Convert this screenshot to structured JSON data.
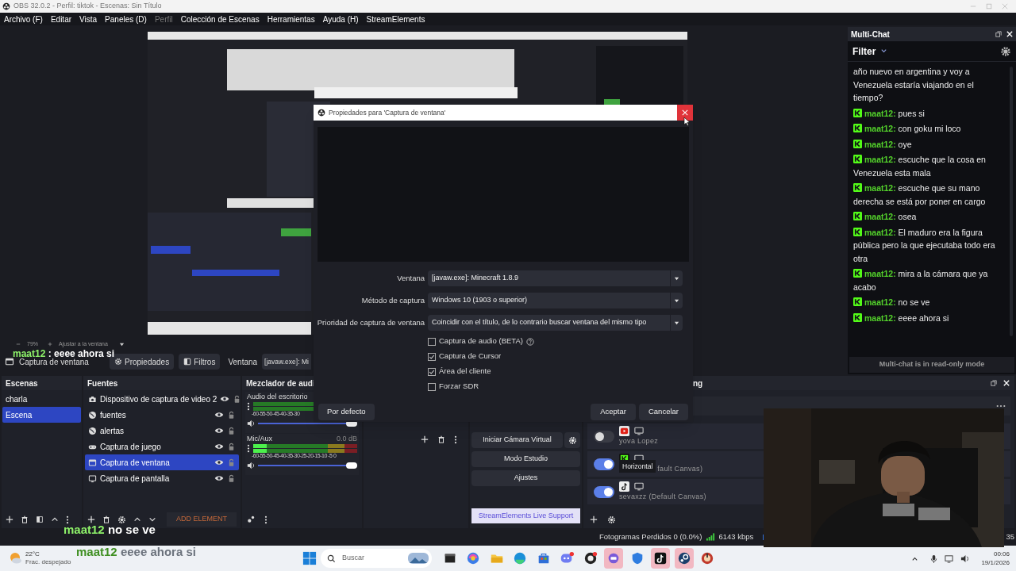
{
  "window": {
    "title": "OBS 32.0.2 - Perfil: tiktok - Escenas: Sin Título",
    "menu": [
      {
        "label": "Archivo (F)",
        "disabled": false
      },
      {
        "label": "Editar",
        "disabled": false
      },
      {
        "label": "Vista",
        "disabled": false
      },
      {
        "label": "Paneles (D)",
        "disabled": false
      },
      {
        "label": "Perfil",
        "disabled": true
      },
      {
        "label": "Colección de Escenas",
        "disabled": false
      },
      {
        "label": "Herramientas",
        "disabled": false
      },
      {
        "label": "Ayuda (H)",
        "disabled": false
      },
      {
        "label": "StreamElements",
        "disabled": false
      }
    ]
  },
  "preview": {
    "kind": "picture",
    "zoom": "79%",
    "fit_label": "Ajustar a la ventana"
  },
  "source_toolbar": {
    "source": "Captura de ventana",
    "buttons": [
      {
        "label": "Propiedades",
        "kind": "gear"
      },
      {
        "label": "Filtros",
        "kind": "filter"
      }
    ],
    "field_label": "Ventana",
    "field_value": "[javaw.exe]: Mi"
  },
  "multichat": {
    "title": "Multi-Chat",
    "filter": "Filter",
    "messages": [
      {
        "text": "año nuevo en argentina y voy a Venezuela estaría viajando en el tiempo?"
      },
      {
        "user": "maat12:",
        "text": "pues si"
      },
      {
        "user": "maat12:",
        "text": "con goku mi loco"
      },
      {
        "user": "maat12:",
        "text": "oye"
      },
      {
        "user": "maat12:",
        "text": "escuche que la cosa en Venezuela esta mala"
      },
      {
        "user": "maat12:",
        "text": "escuche que su mano derecha se está por poner en cargo"
      },
      {
        "user": "maat12:",
        "text": "osea"
      },
      {
        "user": "maat12:",
        "text": "El maduro era la figura pública pero la que ejecutaba todo era otra"
      },
      {
        "user": "maat12:",
        "text": "mira a la cámara que ya acabo"
      },
      {
        "user": "maat12:",
        "text": "no se ve"
      },
      {
        "user": "maat12:",
        "text": "eeee ahora si"
      }
    ],
    "footer": "Multi-chat is in read-only mode"
  },
  "scenes": {
    "title": "Escenas",
    "items": [
      {
        "label": "charla",
        "selected": false
      },
      {
        "label": "Escena",
        "selected": true
      }
    ]
  },
  "sources": {
    "title": "Fuentes",
    "add_button": "ADD ELEMENT",
    "items": [
      {
        "label": "Dispositivo de captura de video 2",
        "kind": "camera",
        "selected": false
      },
      {
        "label": "fuentes",
        "kind": "globe",
        "selected": false
      },
      {
        "label": "alertas",
        "kind": "globe",
        "selected": false
      },
      {
        "label": "Captura de juego",
        "kind": "gamepad",
        "selected": false
      },
      {
        "label": "Captura de ventana",
        "kind": "window",
        "selected": true
      },
      {
        "label": "Captura de pantalla",
        "kind": "monitor",
        "selected": false
      }
    ]
  },
  "mixer": {
    "title": "Mezclador de audi",
    "channels": [
      {
        "name": "Audio del escritorio",
        "ticks": "-60-55-50-45-40-35-30",
        "meter": {
          "level": 0.0
        },
        "volume": {
          "level": 1.0
        }
      },
      {
        "name": "Mic/Aux",
        "reading": "0.0 dB",
        "ticks": "-60-55-50-45-40-35-30-25-20-15-10 -5 0",
        "meter": {
          "level": 0.13
        },
        "volume": {
          "level": 1.0
        }
      }
    ]
  },
  "controls": {
    "buttons": [
      {
        "label": "Iniciar Cámara Virtual",
        "kind": "with_settings"
      },
      {
        "label": "Modo Estudio",
        "kind": "plain"
      },
      {
        "label": "Ajustes",
        "kind": "plain"
      },
      {
        "label": "StreamElements Live Support",
        "kind": "support"
      }
    ]
  },
  "streaming": {
    "title": "ng",
    "targets": [
      {
        "kind": "youtube",
        "on": false,
        "label": "yova Lopez"
      },
      {
        "kind": "kick",
        "on": true,
        "tooltip": "Horizontal",
        "label": "fault Canvas)"
      },
      {
        "kind": "tiktok",
        "on": true,
        "label": "sevaxzz (Default Canvas)"
      }
    ]
  },
  "status_bar": {
    "dropped": "Fotogramas Perdidos 0 (0.0%)",
    "bitrate": "6143 kbps",
    "trailing": "35"
  },
  "dialog": {
    "title": "Propiedades para 'Captura de ventana'",
    "fields": [
      {
        "label": "Ventana",
        "value": "[javaw.exe]: Minecraft 1.8.9"
      },
      {
        "label": "Método de captura",
        "value": "Windows 10 (1903 o superior)"
      },
      {
        "label": "Prioridad de captura de ventana",
        "value": "Coincidir con el título, de lo contrario buscar ventana del mismo tipo"
      }
    ],
    "checkboxes": [
      {
        "label": "Captura de audio (BETA)",
        "checked": false,
        "kind": "with_help"
      },
      {
        "label": "Captura de Cursor",
        "checked": true,
        "kind": "plain"
      },
      {
        "label": "Área del cliente",
        "checked": true,
        "kind": "plain"
      },
      {
        "label": "Forzar SDR",
        "checked": false,
        "kind": "plain"
      }
    ],
    "default_button": "Por defecto",
    "buttons": [
      "Aceptar",
      "Cancelar"
    ]
  },
  "chat_overlay": [
    {
      "user": "maat12",
      "text": ": eeee ahora si",
      "faded": false
    },
    {
      "user": "maat12",
      "text": "no se ve",
      "faded": false
    },
    {
      "user": "maat12",
      "text": "eeee ahora si",
      "faded": true
    }
  ],
  "taskbar": {
    "temperature": "22°C",
    "weather": "Frac. despejado",
    "search_placeholder": "Buscar",
    "time": "00:06",
    "date": "19/1/2026",
    "apps": [
      {
        "kind": "taskview",
        "highlighted": false
      },
      {
        "kind": "copilot",
        "highlighted": false
      },
      {
        "kind": "files",
        "highlighted": false
      },
      {
        "kind": "edge",
        "highlighted": false
      },
      {
        "kind": "store",
        "highlighted": false
      },
      {
        "kind": "discord",
        "highlighted": false
      },
      {
        "kind": "obs",
        "highlighted": false
      },
      {
        "kind": "chat",
        "highlighted": true
      },
      {
        "kind": "shield",
        "highlighted": false
      },
      {
        "kind": "tiktok",
        "highlighted": true
      },
      {
        "kind": "steam",
        "highlighted": true
      },
      {
        "kind": "game",
        "highlighted": false
      }
    ]
  }
}
